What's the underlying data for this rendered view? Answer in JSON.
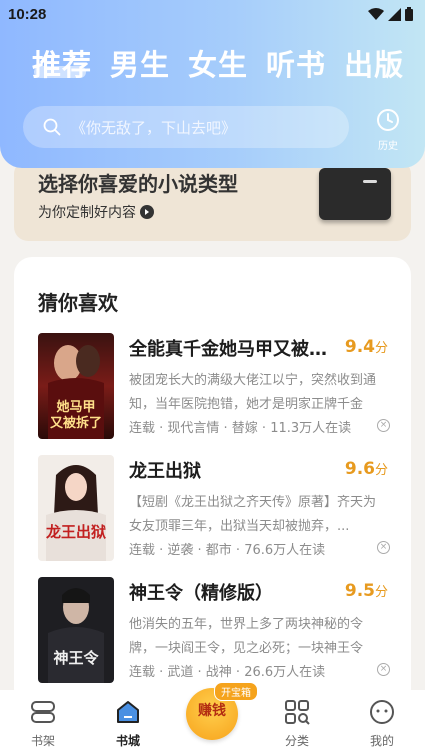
{
  "status": {
    "time": "10:28"
  },
  "tabs": [
    {
      "label": "推荐"
    },
    {
      "label": "男生"
    },
    {
      "label": "女生"
    },
    {
      "label": "听书"
    },
    {
      "label": "出版"
    }
  ],
  "search": {
    "placeholder": "《你无敌了，下山去吧》"
  },
  "history": {
    "label": "历史"
  },
  "banner": {
    "title": "选择你喜爱的小说类型",
    "subtitle": "为你定制好内容"
  },
  "section": {
    "title": "猜你喜欢"
  },
  "books": [
    {
      "title": "全能真千金她马甲又被拆了",
      "score": "9.4",
      "unit": "分",
      "desc": "被团宠长大的满级大佬江以宁，突然收到通知，当年医院抱错，她才是明家正牌千金",
      "meta": "连载 · 现代言情 · 替嫁 · 11.3万人在读",
      "cover_text": "她马甲又被拆了"
    },
    {
      "title": "龙王出狱",
      "score": "9.6",
      "unit": "分",
      "desc": "【短剧《龙王出狱之齐天传》原著】齐天为女友顶罪三年，出狱当天却被抛弃，...",
      "meta": "连载 · 逆袭 · 都市 · 76.6万人在读",
      "cover_text": "龙王出狱"
    },
    {
      "title": "神王令（精修版）",
      "score": "9.5",
      "unit": "分",
      "desc": "他消失的五年，世界上多了两块神秘的令牌，一块阎王令，见之必死；一块神王令",
      "meta": "连载 · 武道 · 战神 · 26.6万人在读",
      "cover_text": "神王令"
    }
  ],
  "nav": {
    "bookshelf": "书架",
    "store": "书城",
    "earn": "赚钱",
    "earn_badge": "开宝箱",
    "category": "分类",
    "mine": "我的"
  },
  "colors": {
    "accent_score": "#e79a1f",
    "header_start": "#8fb8ff",
    "header_end": "#c2e6f4"
  }
}
